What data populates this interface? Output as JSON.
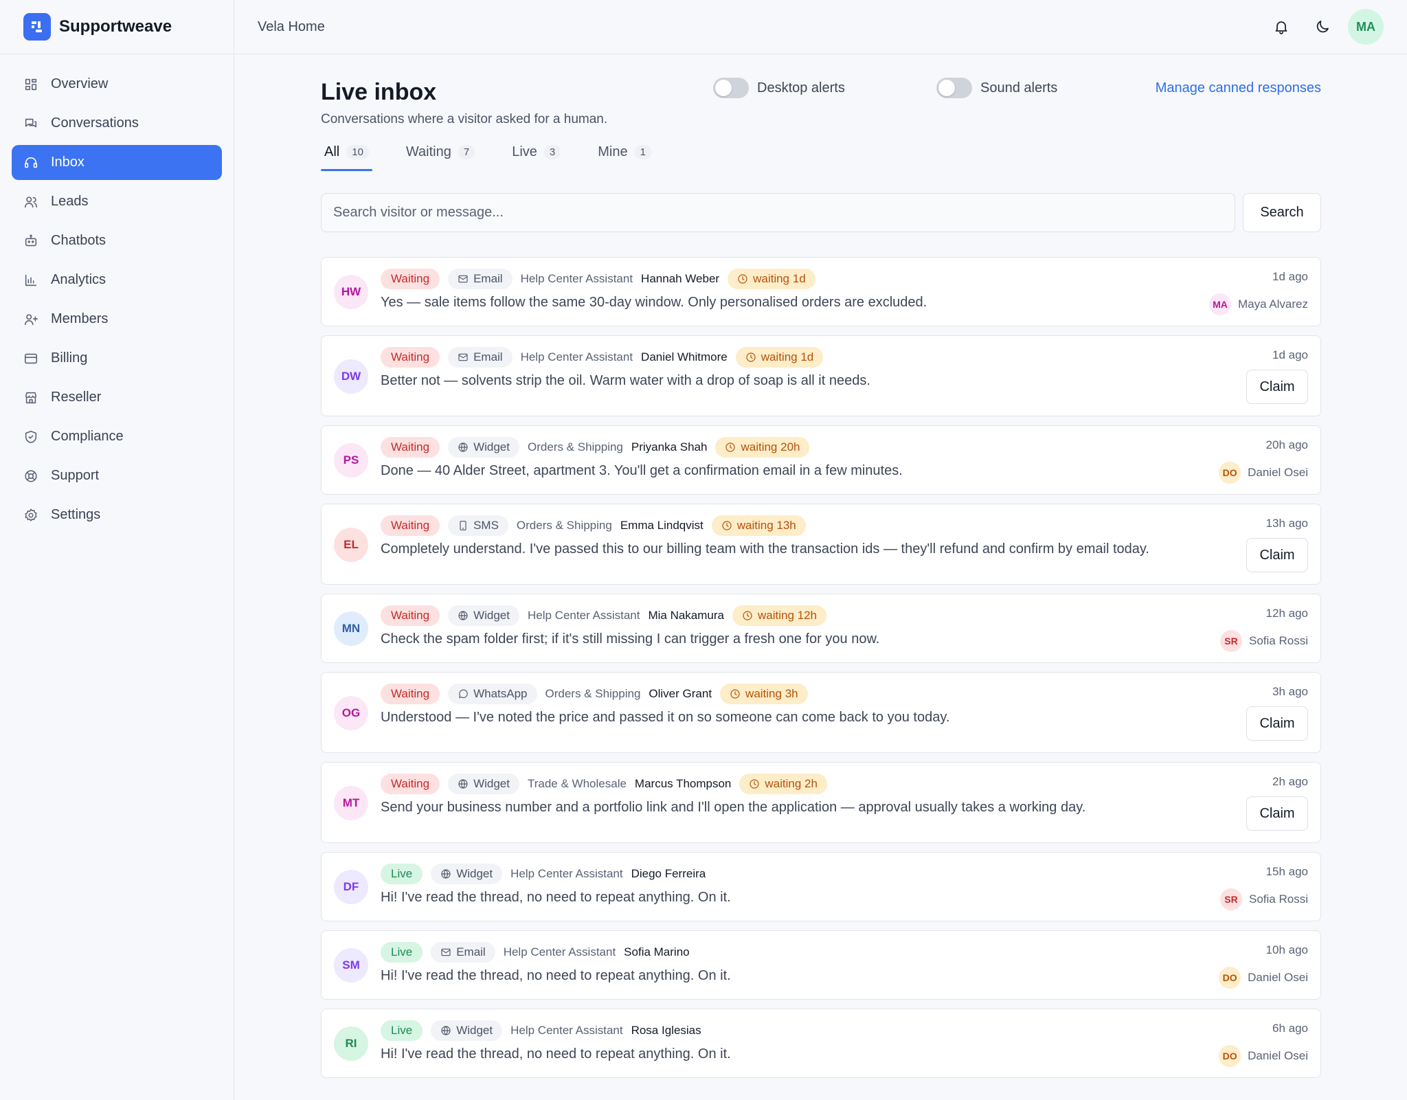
{
  "app": {
    "name": "Supportweave",
    "workspace": "Vela Home"
  },
  "sidebar": {
    "items": [
      {
        "label": "Overview",
        "icon": "grid-icon"
      },
      {
        "label": "Conversations",
        "icon": "chat-icon"
      },
      {
        "label": "Inbox",
        "icon": "headset-icon",
        "active": true
      },
      {
        "label": "Leads",
        "icon": "users-icon"
      },
      {
        "label": "Chatbots",
        "icon": "bot-icon"
      },
      {
        "label": "Analytics",
        "icon": "bar-chart-icon"
      },
      {
        "label": "Members",
        "icon": "user-plus-icon"
      },
      {
        "label": "Billing",
        "icon": "credit-card-icon"
      },
      {
        "label": "Reseller",
        "icon": "store-icon"
      },
      {
        "label": "Compliance",
        "icon": "shield-icon"
      },
      {
        "label": "Support",
        "icon": "lifebuoy-icon"
      },
      {
        "label": "Settings",
        "icon": "gear-icon"
      }
    ]
  },
  "topbar": {
    "user_initials": "MA"
  },
  "page": {
    "title": "Live inbox",
    "subtitle": "Conversations where a visitor asked for a human.",
    "desktop_alerts_label": "Desktop alerts",
    "sound_alerts_label": "Sound alerts",
    "manage_link": "Manage canned responses"
  },
  "tabs": [
    {
      "label": "All",
      "count": "10",
      "active": true
    },
    {
      "label": "Waiting",
      "count": "7"
    },
    {
      "label": "Live",
      "count": "3"
    },
    {
      "label": "Mine",
      "count": "1"
    }
  ],
  "search": {
    "placeholder": "Search visitor or message...",
    "button_label": "Search"
  },
  "colors": {
    "accent": "#3b73f2",
    "waiting_bg": "#fde0e0",
    "waiting_text": "#c42b2b",
    "live_bg": "#d6f5e3",
    "live_text": "#1f8a52",
    "wait_bg": "#fdedc8",
    "wait_text": "#b5520c"
  },
  "conversations": [
    {
      "initials": "HW",
      "avatar_bg": "#fce7f6",
      "avatar_fg": "#b5179e",
      "status": "Waiting",
      "channel": "Email",
      "channel_icon": "mail-icon",
      "bot": "Help Center Assistant",
      "visitor": "Hannah Weber",
      "waiting": "waiting 1d",
      "message": "Yes — sale items follow the same 30-day window. Only personalised orders are excluded.",
      "time": "1d ago",
      "assignee": {
        "initials": "MA",
        "name": "Maya Alvarez",
        "bg": "#fce7f6",
        "fg": "#b5179e"
      },
      "size": "short"
    },
    {
      "initials": "DW",
      "avatar_bg": "#ede9fe",
      "avatar_fg": "#7c3aed",
      "status": "Waiting",
      "channel": "Email",
      "channel_icon": "mail-icon",
      "bot": "Help Center Assistant",
      "visitor": "Daniel Whitmore",
      "waiting": "waiting 1d",
      "message": "Better not — solvents strip the oil. Warm water with a drop of soap is all it needs.",
      "time": "1d ago",
      "claim": "Claim",
      "size": "tall"
    },
    {
      "initials": "PS",
      "avatar_bg": "#fce7f6",
      "avatar_fg": "#b5179e",
      "status": "Waiting",
      "channel": "Widget",
      "channel_icon": "globe-icon",
      "bot": "Orders & Shipping",
      "visitor": "Priyanka Shah",
      "waiting": "waiting 20h",
      "message": "Done — 40 Alder Street, apartment 3. You'll get a confirmation email in a few minutes.",
      "time": "20h ago",
      "assignee": {
        "initials": "DO",
        "name": "Daniel Osei",
        "bg": "#fdedc8",
        "fg": "#b5520c"
      },
      "size": "short"
    },
    {
      "initials": "EL",
      "avatar_bg": "#fde0e0",
      "avatar_fg": "#c42b2b",
      "status": "Waiting",
      "channel": "SMS",
      "channel_icon": "phone-icon",
      "bot": "Orders & Shipping",
      "visitor": "Emma Lindqvist",
      "waiting": "waiting 13h",
      "message": "Completely understand. I've passed this to our billing team with the transaction ids — they'll refund and confirm by email today.",
      "time": "13h ago",
      "claim": "Claim",
      "size": "tall"
    },
    {
      "initials": "MN",
      "avatar_bg": "#e0ecfb",
      "avatar_fg": "#2f5fa8",
      "status": "Waiting",
      "channel": "Widget",
      "channel_icon": "globe-icon",
      "bot": "Help Center Assistant",
      "visitor": "Mia Nakamura",
      "waiting": "waiting 12h",
      "message": "Check the spam folder first; if it's still missing I can trigger a fresh one for you now.",
      "time": "12h ago",
      "assignee": {
        "initials": "SR",
        "name": "Sofia Rossi",
        "bg": "#fde0e0",
        "fg": "#c42b2b"
      },
      "size": "short"
    },
    {
      "initials": "OG",
      "avatar_bg": "#fce7f6",
      "avatar_fg": "#b5179e",
      "status": "Waiting",
      "channel": "WhatsApp",
      "channel_icon": "whatsapp-icon",
      "bot": "Orders & Shipping",
      "visitor": "Oliver Grant",
      "waiting": "waiting 3h",
      "message": "Understood — I've noted the price and passed it on so someone can come back to you today.",
      "time": "3h ago",
      "claim": "Claim",
      "size": "tall"
    },
    {
      "initials": "MT",
      "avatar_bg": "#fce7f6",
      "avatar_fg": "#b5179e",
      "status": "Waiting",
      "channel": "Widget",
      "channel_icon": "globe-icon",
      "bot": "Trade & Wholesale",
      "visitor": "Marcus Thompson",
      "waiting": "waiting 2h",
      "message": "Send your business number and a portfolio link and I'll open the application — approval usually takes a working day.",
      "time": "2h ago",
      "claim": "Claim",
      "size": "tall"
    },
    {
      "initials": "DF",
      "avatar_bg": "#ede9fe",
      "avatar_fg": "#7c3aed",
      "status": "Live",
      "channel": "Widget",
      "channel_icon": "globe-icon",
      "bot": "Help Center Assistant",
      "visitor": "Diego Ferreira",
      "message": "Hi! I've read the thread, no need to repeat anything. On it.",
      "time": "15h ago",
      "assignee": {
        "initials": "SR",
        "name": "Sofia Rossi",
        "bg": "#fde0e0",
        "fg": "#c42b2b"
      },
      "size": "short"
    },
    {
      "initials": "SM",
      "avatar_bg": "#ede9fe",
      "avatar_fg": "#7c3aed",
      "status": "Live",
      "channel": "Email",
      "channel_icon": "mail-icon",
      "bot": "Help Center Assistant",
      "visitor": "Sofia Marino",
      "message": "Hi! I've read the thread, no need to repeat anything. On it.",
      "time": "10h ago",
      "assignee": {
        "initials": "DO",
        "name": "Daniel Osei",
        "bg": "#fdedc8",
        "fg": "#b5520c"
      },
      "size": "short"
    },
    {
      "initials": "RI",
      "avatar_bg": "#d6f5e3",
      "avatar_fg": "#1f8a52",
      "status": "Live",
      "channel": "Widget",
      "channel_icon": "globe-icon",
      "bot": "Help Center Assistant",
      "visitor": "Rosa Iglesias",
      "message": "Hi! I've read the thread, no need to repeat anything. On it.",
      "time": "6h ago",
      "assignee": {
        "initials": "DO",
        "name": "Daniel Osei",
        "bg": "#fdedc8",
        "fg": "#b5520c"
      },
      "size": "short"
    }
  ]
}
